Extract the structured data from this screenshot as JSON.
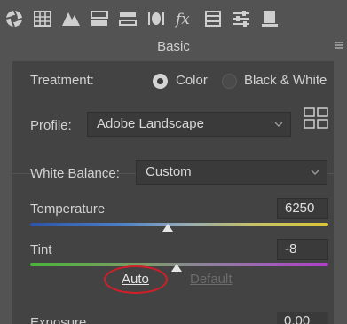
{
  "toolbar": {
    "tools": [
      {
        "icon": "camera-aperture-icon"
      },
      {
        "icon": "grid-icon"
      },
      {
        "icon": "mountains-icon"
      },
      {
        "icon": "split-panel-icon"
      },
      {
        "icon": "split-toning-icon"
      },
      {
        "icon": "lens-icon"
      },
      {
        "icon": "fx-icon"
      },
      {
        "icon": "calibration-icon"
      },
      {
        "icon": "sliders-icon"
      },
      {
        "icon": "snapshots-icon"
      }
    ]
  },
  "panel": {
    "title": "Basic"
  },
  "treatment": {
    "label": "Treatment:",
    "options": [
      "Color",
      "Black & White"
    ],
    "selected": "Color"
  },
  "profile": {
    "label": "Profile:",
    "value": "Adobe Landscape"
  },
  "white_balance": {
    "label": "White Balance:",
    "value": "Custom"
  },
  "temperature": {
    "label": "Temperature",
    "value": "6250",
    "position": 0.46
  },
  "tint": {
    "label": "Tint",
    "value": "-8",
    "position": 0.49
  },
  "tone": {
    "auto_label": "Auto",
    "default_label": "Default"
  },
  "exposure": {
    "label": "Exposure",
    "value": "0.00"
  },
  "colors": {
    "panel_bg": "#535353",
    "section_bg": "#434343",
    "annotation_red": "#d11f29"
  }
}
